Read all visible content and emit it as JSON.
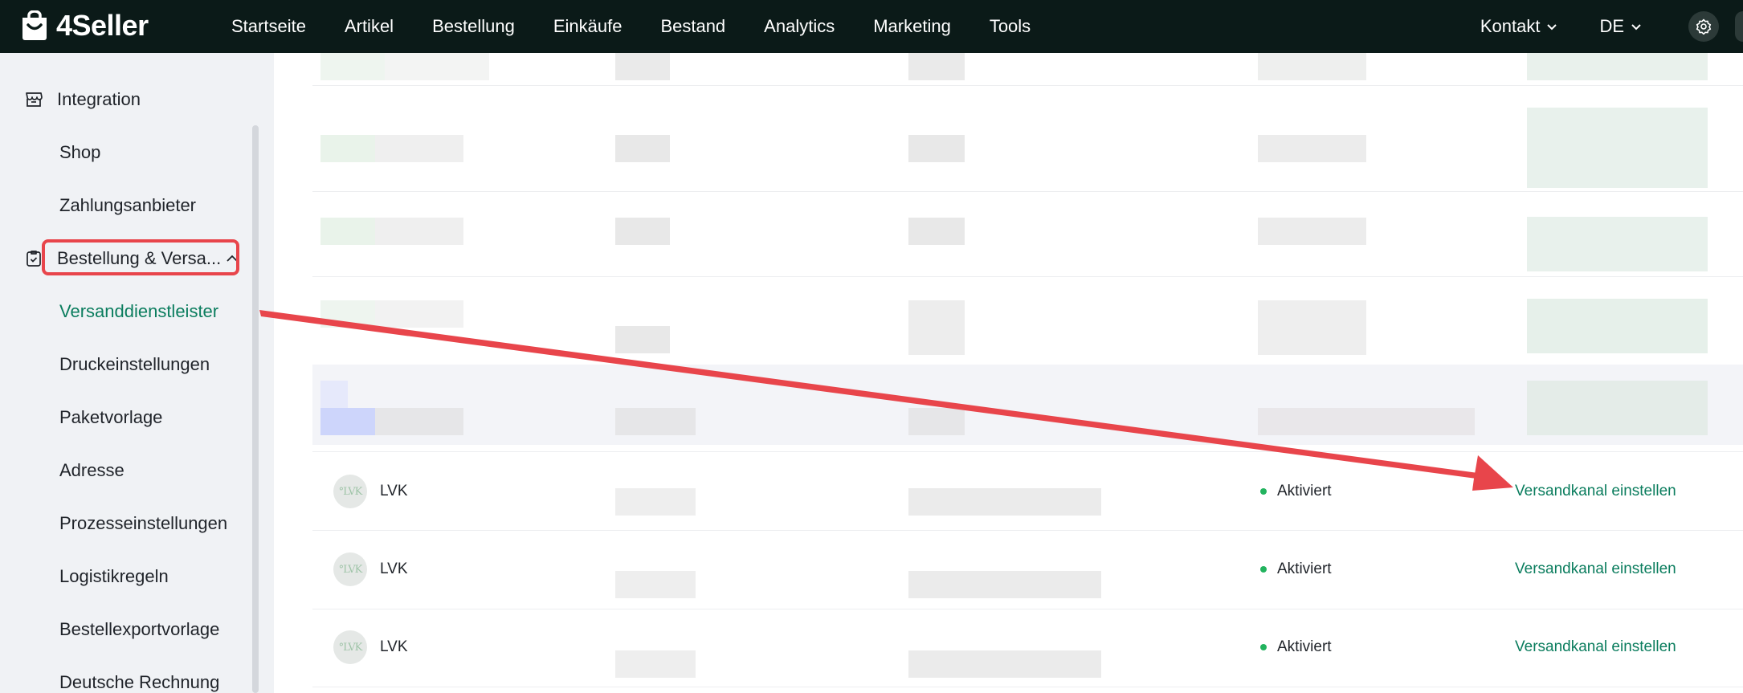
{
  "brand": {
    "name": "4Seller"
  },
  "nav": {
    "items": [
      "Startseite",
      "Artikel",
      "Bestellung",
      "Einkäufe",
      "Bestand",
      "Analytics",
      "Marketing",
      "Tools"
    ],
    "contact": "Kontakt",
    "language": "DE"
  },
  "sidebar": {
    "groups": [
      {
        "label": "Integration",
        "icon": "store-icon",
        "items": [
          "Shop",
          "Zahlungsanbieter"
        ]
      },
      {
        "label": "Bestellung & Versa...",
        "icon": "clipboard-check-icon",
        "expanded": true,
        "items": [
          "Versanddienstleister",
          "Druckeinstellungen",
          "Paketvorlage",
          "Adresse",
          "Prozesseinstellungen",
          "Logistikregeln",
          "Bestellexportvorlage",
          "Deutsche Rechnung"
        ]
      }
    ],
    "active_item": "Versanddienstleister"
  },
  "table": {
    "rows": [
      {
        "carrier": "LVK",
        "logo_text": "°LVK",
        "status": "Aktiviert",
        "action": "Versandkanal einstellen"
      },
      {
        "carrier": "LVK",
        "logo_text": "°LVK",
        "status": "Aktiviert",
        "action": "Versandkanal einstellen"
      },
      {
        "carrier": "LVK",
        "logo_text": "°LVK",
        "status": "Aktiviert",
        "action": "Versandkanal einstellen"
      }
    ]
  },
  "colors": {
    "topbar": "#0b1a18",
    "accent": "#0b7d5e",
    "status_active": "#22b35e",
    "annotation": "#e8454b"
  }
}
